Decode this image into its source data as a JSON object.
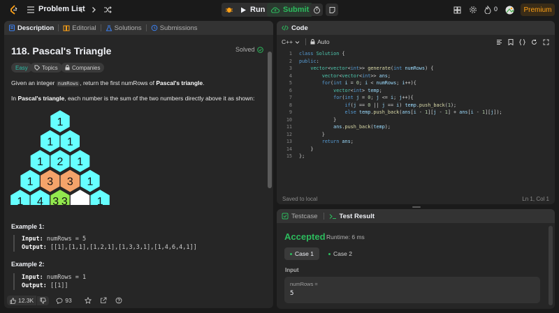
{
  "topbar": {
    "title": "Problem List",
    "run_label": "Run",
    "submit_label": "Submit",
    "streak": "0",
    "premium_label": "Premium"
  },
  "description": {
    "tabs": [
      {
        "label": "Description",
        "icon": "description-icon"
      },
      {
        "label": "Editorial",
        "icon": "book-icon"
      },
      {
        "label": "Solutions",
        "icon": "flask-icon"
      },
      {
        "label": "Submissions",
        "icon": "history-icon"
      }
    ],
    "title": "118. Pascal's Triangle",
    "status": "Solved",
    "difficulty": "Easy",
    "topics_label": "Topics",
    "companies_label": "Companies",
    "p1_pre": "Given an integer ",
    "p1_code": "numRows",
    "p1_mid": ", return the first numRows of ",
    "p1_bold": "Pascal's triangle",
    "p1_post": ".",
    "p2_pre": "In ",
    "p2_bold": "Pascal's triangle",
    "p2_post": ", each number is the sum of the two numbers directly above it as shown:",
    "triangle_rows": [
      [
        "1"
      ],
      [
        "1",
        "1"
      ],
      [
        "1",
        "2",
        "1"
      ],
      [
        "1",
        "3",
        "3",
        "1"
      ],
      [
        "1",
        "4",
        "3",
        "3",
        "",
        "1"
      ]
    ],
    "colors": {
      "cyan": "#66ffff",
      "orange": "#f4a36a",
      "green": "#92e84e",
      "white": "#ffffff"
    },
    "example1_title": "Example 1:",
    "example1_input_label": "Input:",
    "example1_input": "numRows = 5",
    "example1_output_label": "Output:",
    "example1_output": "[[1],[1,1],[1,2,1],[1,3,3,1],[1,4,6,4,1]]",
    "example2_title": "Example 2:",
    "example2_input_label": "Input:",
    "example2_input": "numRows = 1",
    "example2_output_label": "Output:",
    "example2_output": "[[1]]",
    "likes": "12.3K",
    "comments": "93"
  },
  "code": {
    "tab_label": "Code",
    "language": "C++",
    "auto_label": "Auto",
    "saved": "Saved to local",
    "cursor": "Ln 1, Col 1",
    "lines": [
      "class Solution {",
      "public:",
      "    vector<vector<int>> generate(int numRows) {",
      "        vector<vector<int>> ans;",
      "        for(int i = 0; i < numRows; i++){",
      "            vector<int> temp;",
      "            for(int j = 0; j <= i; j++){",
      "                if(j == 0 || j == i) temp.push_back(1);",
      "                else temp.push_back(ans[i - 1][j - 1] + ans[i - 1][j]);",
      "            }",
      "            ans.push_back(temp);",
      "        }",
      "        return ans;",
      "    }",
      "};"
    ]
  },
  "test": {
    "testcase_tab": "Testcase",
    "result_tab": "Test Result",
    "verdict": "Accepted",
    "runtime": "Runtime: 6 ms",
    "case1": "Case 1",
    "case2": "Case 2",
    "input_label": "Input",
    "input_name": "numRows =",
    "input_value": "5"
  }
}
